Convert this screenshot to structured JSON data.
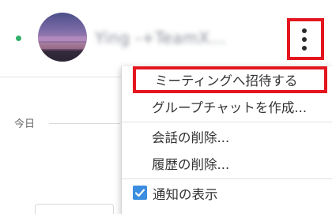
{
  "header": {
    "contact_name": "Ying -+TeamX...",
    "more_icon": "vertical-ellipsis-icon",
    "status_color": "#2fb06b"
  },
  "conversation": {
    "date_divider": "今日"
  },
  "menu": {
    "items": [
      {
        "label": "ミーティングへ招待する",
        "highlighted": true
      },
      {
        "label": "グループチャットを作成..."
      },
      {
        "label": "会話の削除..."
      },
      {
        "label": "履歴の削除..."
      },
      {
        "label": "通知の表示",
        "checked": true
      }
    ]
  },
  "colors": {
    "highlight": "#e4151e",
    "checkbox": "#3b8de0"
  }
}
